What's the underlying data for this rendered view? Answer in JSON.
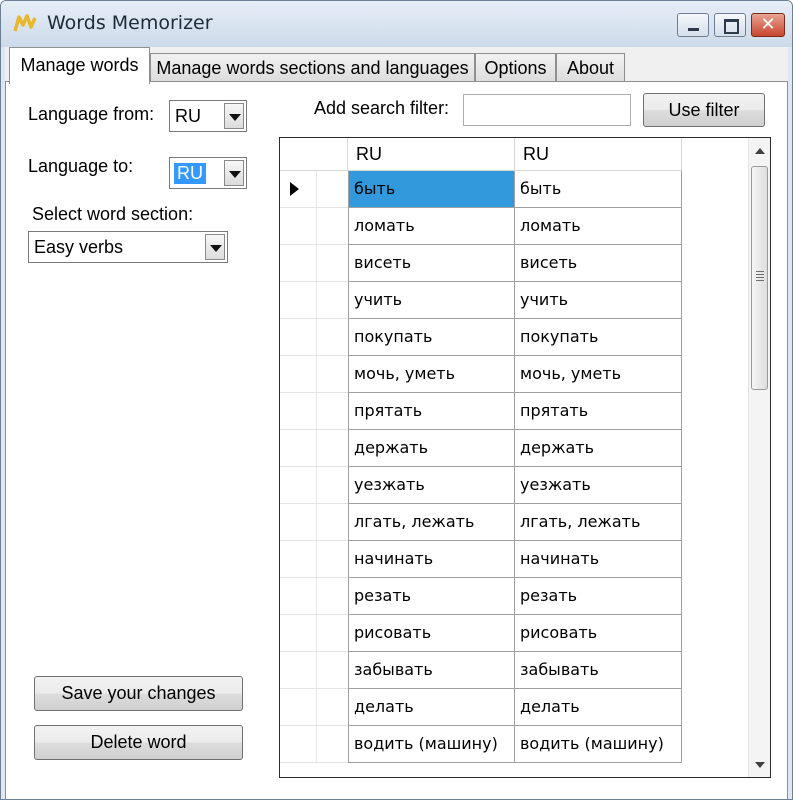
{
  "window": {
    "title": "Words Memorizer",
    "icon": "app-logo-icon",
    "controls": [
      "minimize-icon",
      "maximize-icon",
      "close-icon"
    ],
    "close_glyph": "✕"
  },
  "tabs": [
    {
      "label": "Manage words",
      "active": true
    },
    {
      "label": "Manage words sections and languages",
      "active": false
    },
    {
      "label": "Options",
      "active": false
    },
    {
      "label": "About",
      "active": false
    }
  ],
  "left": {
    "language_from_label": "Language from:",
    "language_from_value": "RU",
    "language_to_label": "Language to:",
    "language_to_value": "RU",
    "section_label": "Select word section:",
    "section_value": "Easy verbs",
    "save_button": "Save your changes",
    "delete_button": "Delete word"
  },
  "filter": {
    "label": "Add search filter:",
    "value": "",
    "button": "Use filter"
  },
  "grid": {
    "columns": [
      "RU",
      "RU"
    ],
    "selected_row": 0,
    "rows": [
      [
        "быть",
        "быть"
      ],
      [
        "ломать",
        "ломать"
      ],
      [
        "висеть",
        "висеть"
      ],
      [
        "учить",
        "учить"
      ],
      [
        "покупать",
        "покупать"
      ],
      [
        "мочь, уметь",
        "мочь, уметь"
      ],
      [
        "прятать",
        "прятать"
      ],
      [
        "держать",
        "держать"
      ],
      [
        "уезжать",
        "уезжать"
      ],
      [
        "лгать, лежать",
        "лгать, лежать"
      ],
      [
        "начинать",
        "начинать"
      ],
      [
        "резать",
        "резать"
      ],
      [
        "рисовать",
        "рисовать"
      ],
      [
        "забывать",
        "забывать"
      ],
      [
        "делать",
        "делать"
      ],
      [
        "водить (машину)",
        "водить (машину)"
      ]
    ]
  },
  "colors": {
    "selection": "#3399dd",
    "window_frame": "#cddaea",
    "close_button": "#c8452e"
  }
}
